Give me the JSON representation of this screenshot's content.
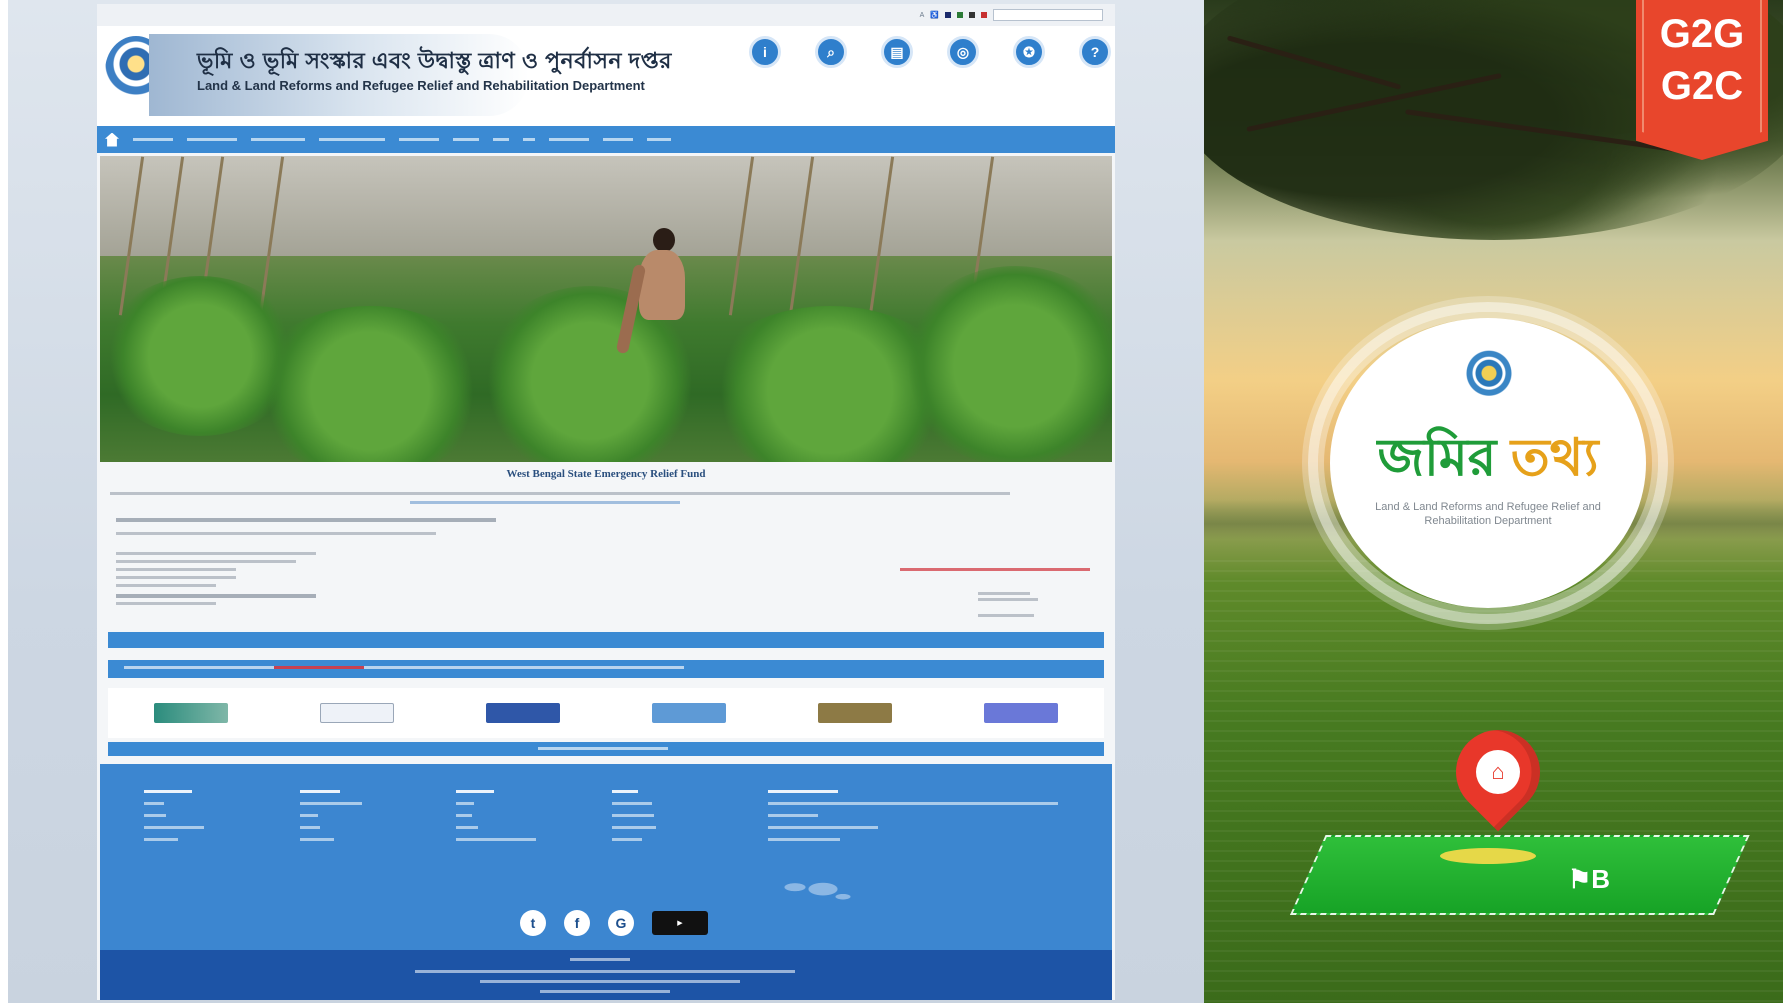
{
  "site": {
    "header": {
      "dept_bengali": "ভূমি ও ভূমি সংস্কার এবং উদ্বাস্তু ত্রাণ ও পুনর্বাসন দপ্তর",
      "dept_english": "Land & Land Reforms and Refugee Relief and Rehabilitation Department"
    },
    "quick_links": [
      {
        "icon": "info-icon",
        "glyph": "i"
      },
      {
        "icon": "search-icon",
        "glyph": "⌕"
      },
      {
        "icon": "document-icon",
        "glyph": "▤"
      },
      {
        "icon": "status-icon",
        "glyph": "◎"
      },
      {
        "icon": "banglar-bhumi-icon",
        "glyph": "✪"
      },
      {
        "icon": "help-icon",
        "glyph": "?"
      }
    ],
    "content": {
      "title": "West Bengal State Emergency Relief Fund"
    },
    "colors": {
      "nav_blue": "#3b8ad3",
      "footer_blue": "#3c86d0",
      "copyright_blue": "#1d54a6"
    }
  },
  "promo": {
    "ribbon_line1": "G2G",
    "ribbon_line2": "G2C",
    "badge_word1": "জমির",
    "badge_word2": "তথ্য",
    "badge_subtitle": "Land & Land Reforms and Refugee Relief and Rehabilitation Department",
    "colors": {
      "ribbon": "#e8462c",
      "title_green": "#1f9c39",
      "title_orange": "#e6a11a",
      "pin_red": "#e8372a"
    }
  }
}
